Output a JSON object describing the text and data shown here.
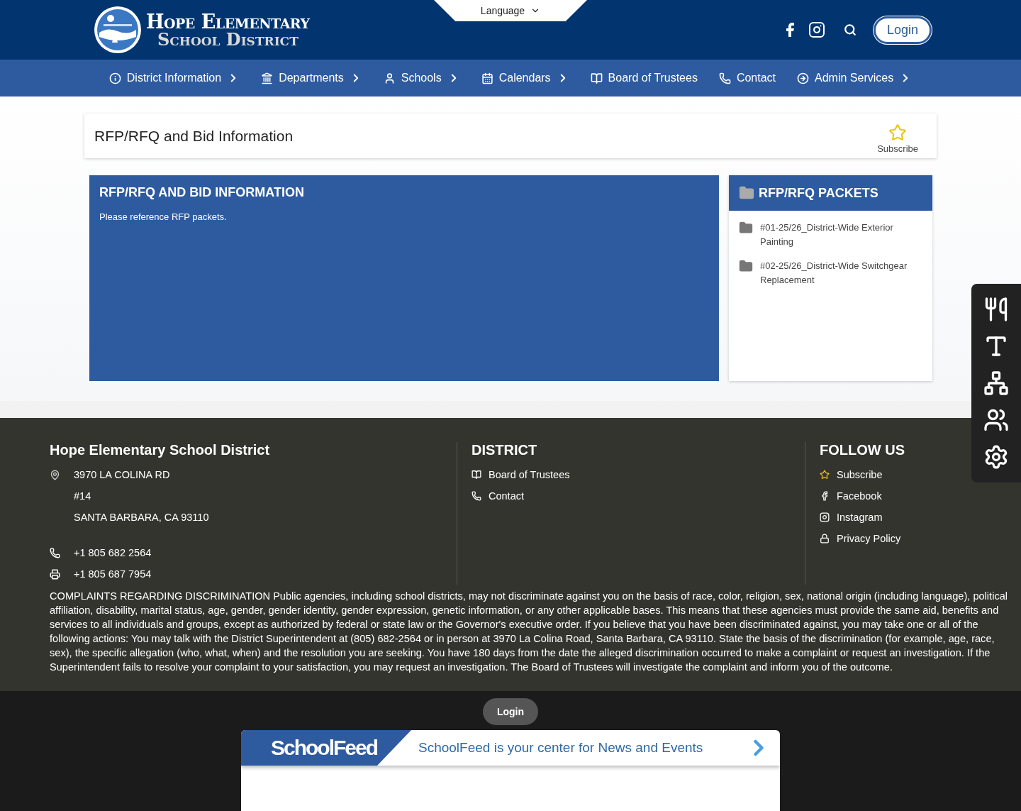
{
  "header": {
    "logo_line_1": "Hope Elementary",
    "logo_line_2": "School District",
    "language": "Language",
    "login": "Login"
  },
  "nav": [
    {
      "label": "District Information",
      "has_submenu": true
    },
    {
      "label": "Departments",
      "has_submenu": true
    },
    {
      "label": "Schools",
      "has_submenu": true
    },
    {
      "label": "Calendars",
      "has_submenu": true
    },
    {
      "label": "Board of Trustees",
      "has_submenu": false
    },
    {
      "label": "Contact",
      "has_submenu": false
    },
    {
      "label": "Admin Services",
      "has_submenu": true
    }
  ],
  "page": {
    "title": "RFP/RFQ and Bid Information",
    "subscribe": "Subscribe"
  },
  "main_panel": {
    "title": "RFP/RFQ AND BID INFORMATION",
    "body": "Please reference RFP packets."
  },
  "packets": {
    "title": "RFP/RFQ PACKETS",
    "items": [
      "#01-25/26_District-Wide Exterior Painting",
      "#02-25/26_District-Wide Switchgear Replacement"
    ]
  },
  "footer": {
    "name": "Hope Elementary School District",
    "address": [
      "3970 LA COLINA RD",
      "#14",
      "SANTA BARBARA, CA 93110"
    ],
    "phones": [
      "+1 805 682 2564",
      "+1 805 687 7954"
    ],
    "district_title": "DISTRICT",
    "district_links": [
      "Board of Trustees",
      "Contact"
    ],
    "follow_title": "FOLLOW US",
    "follow_links": [
      "Subscribe",
      "Facebook",
      "Instagram",
      "Privacy Policy"
    ],
    "notice": "COMPLAINTS REGARDING DISCRIMINATION Public agencies, including school districts, may not discriminate against you on the basis of race, color, religion, sex, national origin (including language), political affiliation, disability, marital status, age, gender, gender identity, gender expression, genetic information, or any other applicable bases. This means that these agencies must provide the same aid, benefits and services to all individuals and groups, except as authorized by federal or state law or the Governor's executive order. If you believe that you have been discriminated against, you may take one or all of the following actions: You may talk with the District Superintendent at (805) 682-2564 or in person at 3970 La Colina Road, Santa Barbara, CA 93110. State the basis of the discrimination (for example, age, race, sex), the specific allegation (who, what, when) and the resolution you are seeking. You have 180 days from the date the alleged discrimination occurred to make a complaint or request an investigation. If the Superintendent fails to resolve your complaint to your satisfaction, you may request an investigation. The Board of Trustees will investigate the complaint and inform you of the outcome."
  },
  "bottom": {
    "login": "Login",
    "feed_logo": "SchoolFeed",
    "feed_text": "SchoolFeed is your center for News and Events"
  }
}
